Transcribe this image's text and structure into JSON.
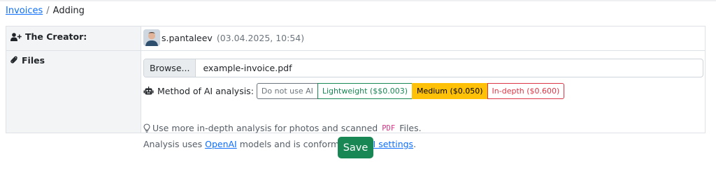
{
  "breadcrumb": {
    "parent": "Invoices",
    "separator": "/",
    "current": "Adding"
  },
  "creator": {
    "label": "The Creator:",
    "username": "s.pantaleev",
    "timestamp": "(03.04.2025, 10:54)"
  },
  "files": {
    "label": "Files",
    "browse_label": "Browse...",
    "file_name": "example-invoice.pdf"
  },
  "ai_analysis": {
    "label": "Method of AI analysis:",
    "options": [
      {
        "label": "Do not use AI",
        "color": "#6c757d",
        "selected": false
      },
      {
        "label": "Lightweight ($$0.003)",
        "color": "#198754",
        "selected": false
      },
      {
        "label": "Medium ($0.050)",
        "color": "#ffc107",
        "selected": true
      },
      {
        "label": "In-depth ($0.600)",
        "color": "#dc3545",
        "selected": false
      }
    ]
  },
  "hint": {
    "before": "Use more in-depth analysis for photos and scanned",
    "code": "PDF",
    "after": "Files."
  },
  "note": {
    "text1": "Analysis uses",
    "link1": "OpenAI",
    "text2": "models and is conforming to",
    "link2": "AI settings",
    "text3": "."
  },
  "save_label": "Save",
  "colors": {
    "primary_link": "#0d6efd",
    "save_button": "#198754",
    "label_background": "#f3f4f5"
  },
  "icons": [
    "user-plus-icon",
    "paperclip-icon",
    "robot-icon",
    "lightbulb-icon"
  ]
}
